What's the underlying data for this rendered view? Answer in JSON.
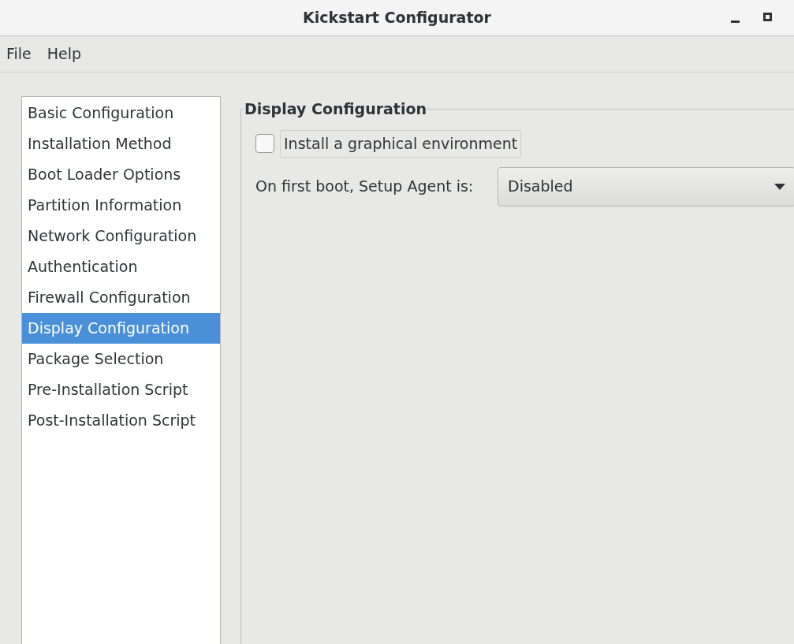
{
  "window": {
    "title": "Kickstart Configurator"
  },
  "menu": [
    "File",
    "Help"
  ],
  "sidebar": {
    "items": [
      {
        "label": "Basic Configuration",
        "selected": false
      },
      {
        "label": "Installation Method",
        "selected": false
      },
      {
        "label": "Boot Loader Options",
        "selected": false
      },
      {
        "label": "Partition Information",
        "selected": false
      },
      {
        "label": "Network Configuration",
        "selected": false
      },
      {
        "label": "Authentication",
        "selected": false
      },
      {
        "label": "Firewall Configuration",
        "selected": false
      },
      {
        "label": "Display Configuration",
        "selected": true
      },
      {
        "label": "Package Selection",
        "selected": false
      },
      {
        "label": "Pre-Installation Script",
        "selected": false
      },
      {
        "label": "Post-Installation Script",
        "selected": false
      }
    ]
  },
  "section": {
    "title": "Display Configuration",
    "graphical": {
      "label": "Install a graphical environment",
      "checked": false
    },
    "setup_agent": {
      "label": "On first boot, Setup Agent is:",
      "value": "Disabled"
    }
  }
}
